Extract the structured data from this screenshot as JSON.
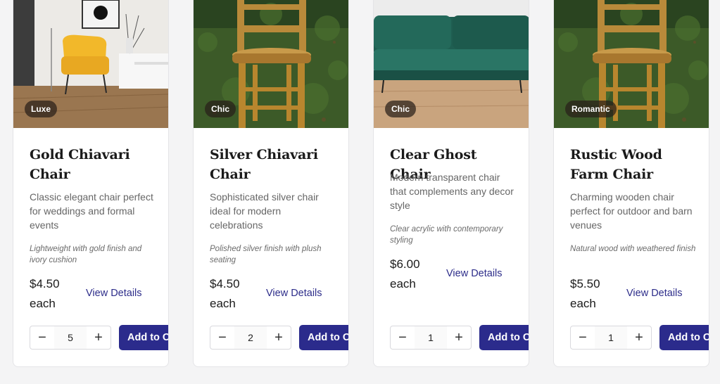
{
  "products": [
    {
      "tag": "Luxe",
      "title": "Gold Chiavari Chair",
      "description": "Classic elegant chair perfect for weddings and formal events",
      "feature": "Lightweight with gold finish and ivory cushion",
      "price": "$4.50 each",
      "view_label": "View Details",
      "quantity": "5",
      "add_label": "Add to Cart",
      "image": "yellow-armchair-photo"
    },
    {
      "tag": "Chic",
      "title": "Silver Chiavari Chair",
      "description": "Sophisticated silver chair ideal for modern celebrations",
      "feature": "Polished silver finish with plush seating",
      "price": "$4.50 each",
      "view_label": "View Details",
      "quantity": "2",
      "add_label": "Add to Cart",
      "image": "wooden-chair-on-grass-photo"
    },
    {
      "tag": "Chic",
      "title": "Clear Ghost Chair",
      "description": "Modern transparent chair that complements any decor style",
      "feature": "Clear acrylic with contemporary styling",
      "price": "$6.00 each",
      "view_label": "View Details",
      "quantity": "1",
      "add_label": "Add to Cart",
      "image": "green-velvet-sofa-photo"
    },
    {
      "tag": "Romantic",
      "title": "Rustic Wood Farm Chair",
      "description": "Charming wooden chair perfect for outdoor and barn venues",
      "feature": "Natural wood with weathered finish",
      "price": "$5.50 each",
      "view_label": "View Details",
      "quantity": "1",
      "add_label": "Add to Cart",
      "image": "wooden-chair-on-grass-photo"
    }
  ],
  "icons": {
    "minus": "minus-icon",
    "plus": "plus-icon"
  },
  "colors": {
    "primary": "#2b2b8c",
    "link": "#2d2d8a",
    "tag_bg": "#2b1f19"
  }
}
